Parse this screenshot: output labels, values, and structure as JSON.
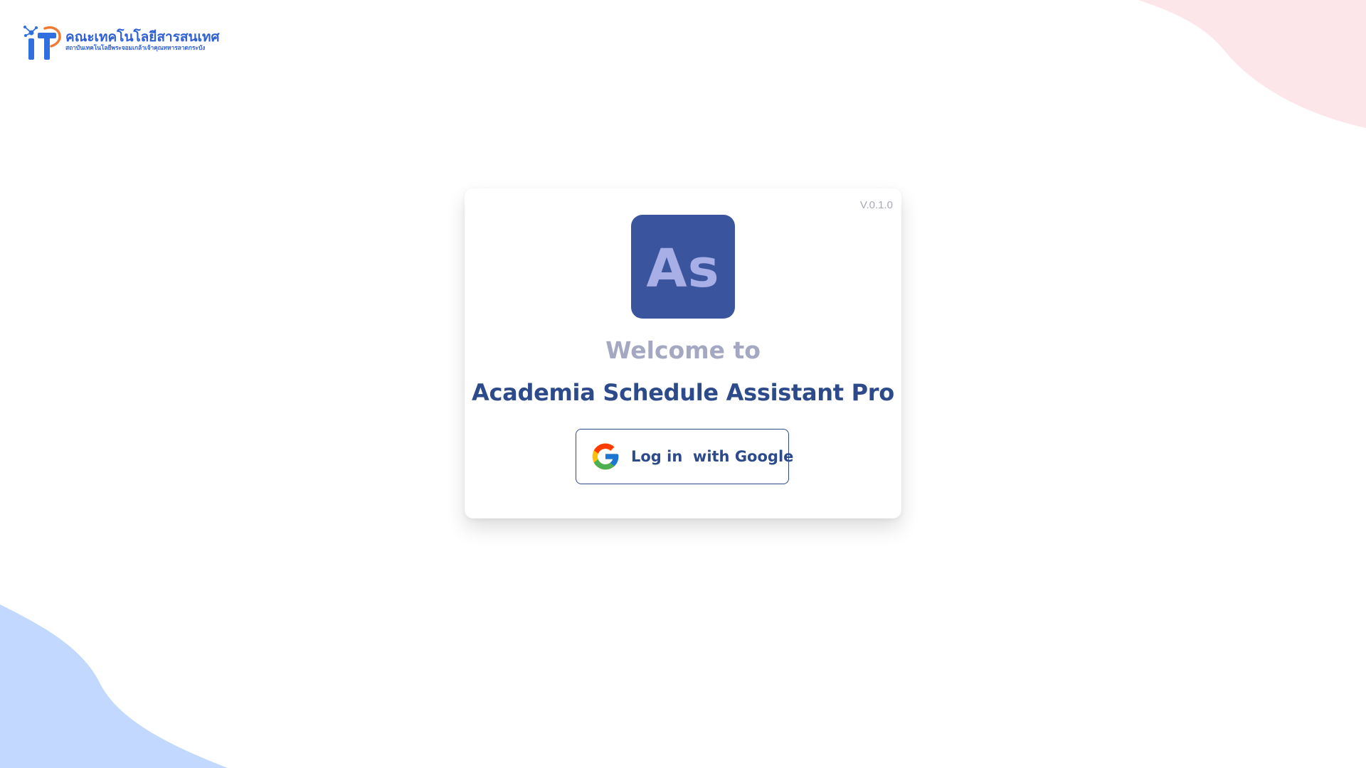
{
  "branding": {
    "faculty_title": "คณะเทคโนโลยีสารสนเทศ",
    "institute_name": "สถาบันเทคโนโลยีพระจอมเกล้าเจ้าคุณทหารลาดกระบัง",
    "logo_icon": "it-faculty-logo",
    "logo_letters": "IT"
  },
  "card": {
    "version": "V.0.1.0",
    "app_icon_text": "As",
    "welcome_text": "Welcome to",
    "app_name": "Academia Schedule Assistant Pro",
    "login_button": {
      "label": "Log in  with Google",
      "icon": "google-icon"
    }
  },
  "colors": {
    "app_icon_bg": "#3a559e",
    "app_icon_text": "#a8aee6",
    "primary_text": "#2d4a8a",
    "welcome_text": "#a5a8c2",
    "version_text": "#a9a9b3",
    "blob_top_right": "#fde6ea",
    "blob_bottom_left": "#c2d8ff"
  }
}
